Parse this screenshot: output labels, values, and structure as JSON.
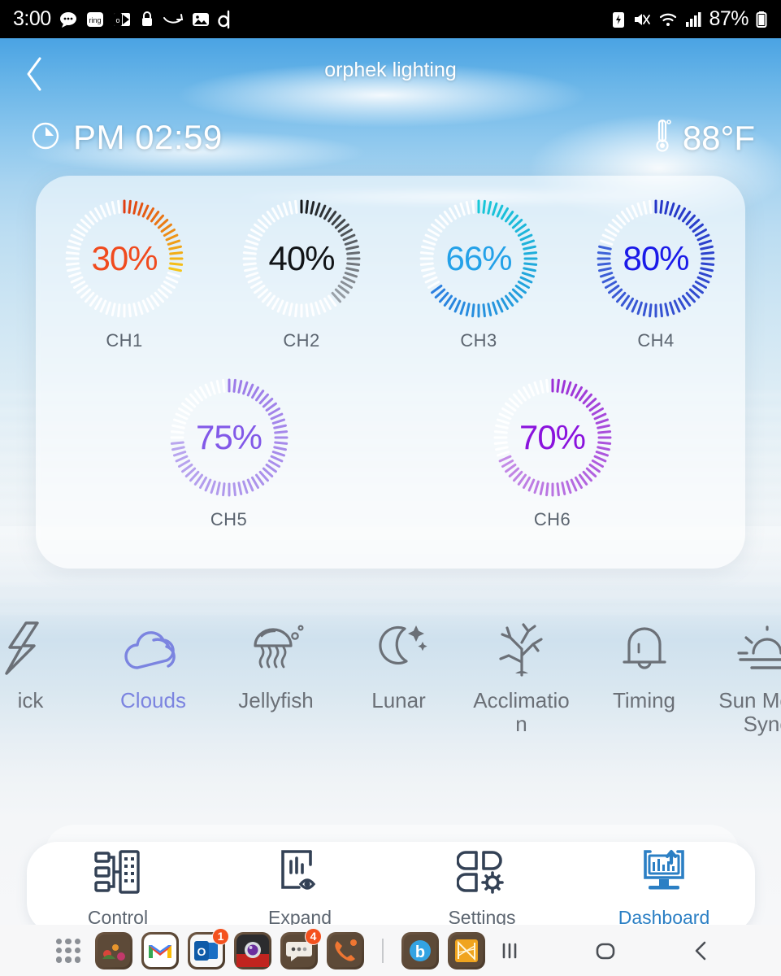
{
  "status_bar": {
    "time": "3:00",
    "battery_percent": "87%",
    "left_icons": [
      "chat-bubble-icon",
      "ring-app-icon",
      "outlook-icon",
      "lock-icon",
      "swipe-arrow-icon",
      "photo-icon",
      "dashlane-icon"
    ],
    "right_icons": [
      "battery-saver-icon",
      "mute-vibrate-icon",
      "wifi-icon",
      "cellular-signal-icon",
      "battery-icon"
    ]
  },
  "header": {
    "back_icon": "back-chevron-icon",
    "title": "orphek lighting",
    "clock_icon": "clock-icon",
    "time": "PM 02:59",
    "temp_icon": "thermometer-icon",
    "temperature": "88°F"
  },
  "channels": [
    {
      "label": "CH1",
      "value": 30,
      "value_text": "30%",
      "text_color": "#f04a1e",
      "tick_from": "#e03c12",
      "tick_to": "#f5c518"
    },
    {
      "label": "CH2",
      "value": 40,
      "value_text": "40%",
      "text_color": "#111417",
      "tick_from": "#15181b",
      "tick_to": "#9aa1a8"
    },
    {
      "label": "CH3",
      "value": 66,
      "value_text": "66%",
      "text_color": "#24a1e8",
      "tick_from": "#18c8d8",
      "tick_to": "#2b7fe0"
    },
    {
      "label": "CH4",
      "value": 80,
      "value_text": "80%",
      "text_color": "#1a1ae8",
      "tick_from": "#2536c8",
      "tick_to": "#3f63d8"
    },
    {
      "label": "CH5",
      "value": 75,
      "value_text": "75%",
      "text_color": "#8259e8",
      "tick_from": "#9b7ae8",
      "tick_to": "#b9a6ee"
    },
    {
      "label": "CH6",
      "value": 70,
      "value_text": "70%",
      "text_color": "#8a13dd",
      "tick_from": "#9b2fd6",
      "tick_to": "#c48ce6"
    }
  ],
  "modes": [
    {
      "label": "ick",
      "icon": "lightning-bolt-icon",
      "active": false
    },
    {
      "label": "Clouds",
      "icon": "cloud-icon",
      "active": true
    },
    {
      "label": "Jellyfish",
      "icon": "jellyfish-icon",
      "active": false
    },
    {
      "label": "Lunar",
      "icon": "moon-stars-icon",
      "active": false
    },
    {
      "label": "Acclimation",
      "icon": "coral-icon",
      "active": false
    },
    {
      "label": "Timing",
      "icon": "bell-icon",
      "active": false
    },
    {
      "label": "Sun Moon Sync",
      "icon": "sunrise-icon",
      "active": false
    }
  ],
  "tabs": [
    {
      "label": "Control",
      "icon": "control-network-icon",
      "active": false
    },
    {
      "label": "Expand",
      "icon": "expand-preview-icon",
      "active": false
    },
    {
      "label": "Settings",
      "icon": "settings-gear-icon",
      "active": false
    },
    {
      "label": "Dashboard",
      "icon": "dashboard-monitor-icon",
      "active": true
    }
  ],
  "dock": {
    "app_drawer_icon": "app-drawer-icon",
    "apps": [
      {
        "name": "gallery-app-icon",
        "badge": ""
      },
      {
        "name": "gmail-app-icon",
        "badge": ""
      },
      {
        "name": "outlook-app-icon",
        "badge": "1"
      },
      {
        "name": "camera-app-icon",
        "badge": ""
      },
      {
        "name": "messages-app-icon",
        "badge": "4"
      },
      {
        "name": "phone-app-icon",
        "badge": ""
      },
      {
        "name": "bluebubbles-app-icon",
        "badge": ""
      },
      {
        "name": "orphek-app-icon",
        "badge": ""
      }
    ],
    "nav": [
      {
        "name": "recents-button",
        "icon": "recents-icon"
      },
      {
        "name": "home-button",
        "icon": "home-icon"
      },
      {
        "name": "back-button",
        "icon": "back-icon"
      }
    ]
  },
  "colors": {
    "accent_blue": "#2b7fc4",
    "accent_purple": "#7b84e0",
    "tab_icon_dark": "#334155"
  }
}
